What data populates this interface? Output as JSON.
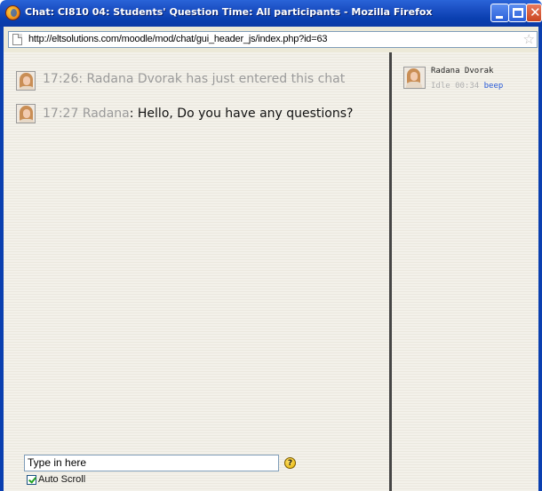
{
  "window": {
    "title": "Chat: CI810 04: Students' Question Time: All participants - Mozilla Firefox"
  },
  "address_bar": {
    "url": "http://eltsolutions.com/moodle/mod/chat/gui_header_js/index.php?id=63"
  },
  "messages": [
    {
      "type": "system",
      "text": "17:26: Radana Dvorak has just entered this chat"
    },
    {
      "type": "message",
      "time": "17:27",
      "author": "Radana",
      "separator": ": ",
      "body": "Hello, Do you have any questions?"
    }
  ],
  "input": {
    "value": "Type in here"
  },
  "auto_scroll": {
    "label": "Auto Scroll",
    "checked": true
  },
  "users": [
    {
      "name": "Radana Dvorak",
      "idle": "Idle 00:34",
      "beep_label": "beep"
    }
  ],
  "icons": {
    "app": "firefox-icon",
    "page": "page-icon",
    "bookmark": "star-icon",
    "help": "help-icon"
  },
  "colors": {
    "titlebar": "#0a3fb0",
    "content_bg": "#f1efe8",
    "system_text": "#9a9a9a",
    "link": "#2a5bd7"
  }
}
